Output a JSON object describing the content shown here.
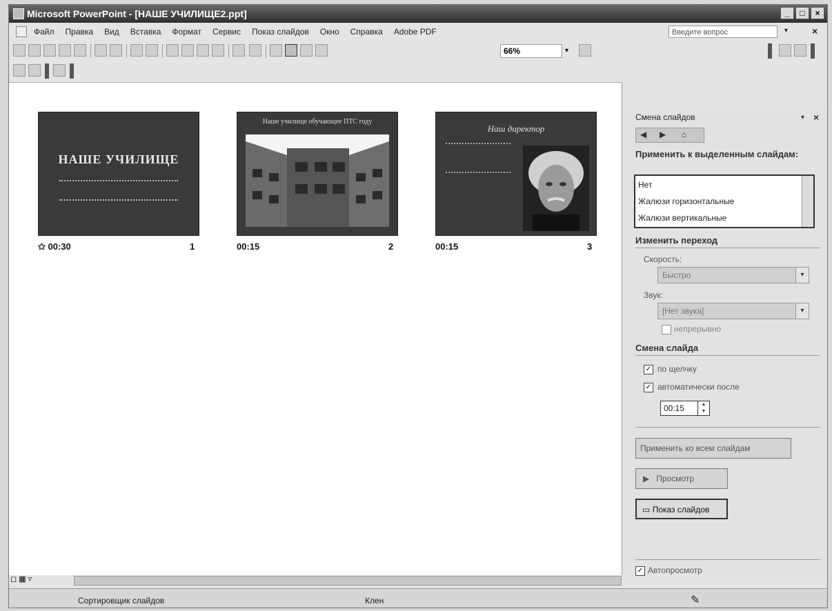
{
  "window": {
    "title": "Microsoft PowerPoint - [НАШЕ УЧИЛИЩЕ2.ppt]",
    "buttons": [
      "_",
      "□",
      "×"
    ]
  },
  "menu": {
    "items": [
      "Файл",
      "Правка",
      "Вид",
      "Вставка",
      "Формат",
      "Сервис",
      "Показ слайдов",
      "Окно",
      "Справка",
      "Adobe PDF"
    ],
    "ask_placeholder": "Введите вопрос",
    "dropdown_arrow": "▾",
    "close": "×"
  },
  "toolbar": {
    "zoom": "66%",
    "zoom_arrow": "▾"
  },
  "slides": [
    {
      "title": "НАШЕ УЧИЛИЩЕ",
      "time": "00:30",
      "number": "1"
    },
    {
      "title": "Наше училище обучающее ПТС году",
      "time": "00:15",
      "number": "2"
    },
    {
      "title": "Наш директор",
      "time": "00:15",
      "number": "3"
    }
  ],
  "task_pane": {
    "title": "Смена слайдов",
    "apply_heading": "Применить к выделенным слайдам:",
    "transitions": [
      "Нет",
      "Жалюзи горизонтальные",
      "Жалюзи вертикальные"
    ],
    "modify_heading": "Изменить переход",
    "speed_label": "Скорость:",
    "speed_value": "Быстро",
    "sound_label": "Звук:",
    "sound_value": "[Нет звука]",
    "loop_label": "непрерывно",
    "advance_heading": "Смена слайда",
    "on_click_label": "по щелчку",
    "auto_label": "автоматически после",
    "auto_time": "00:15",
    "apply_all_button": "Применить ко всем слайдам",
    "preview_button": "Просмотр",
    "slideshow_button": "Показ слайдов",
    "autopreview_label": "Автопросмотр"
  },
  "status": {
    "view": "Сортировщик слайдов",
    "design": "Клен"
  },
  "colors": {
    "titlebar": "#3a3a3a",
    "slide_bg": "#3a3a3a"
  }
}
